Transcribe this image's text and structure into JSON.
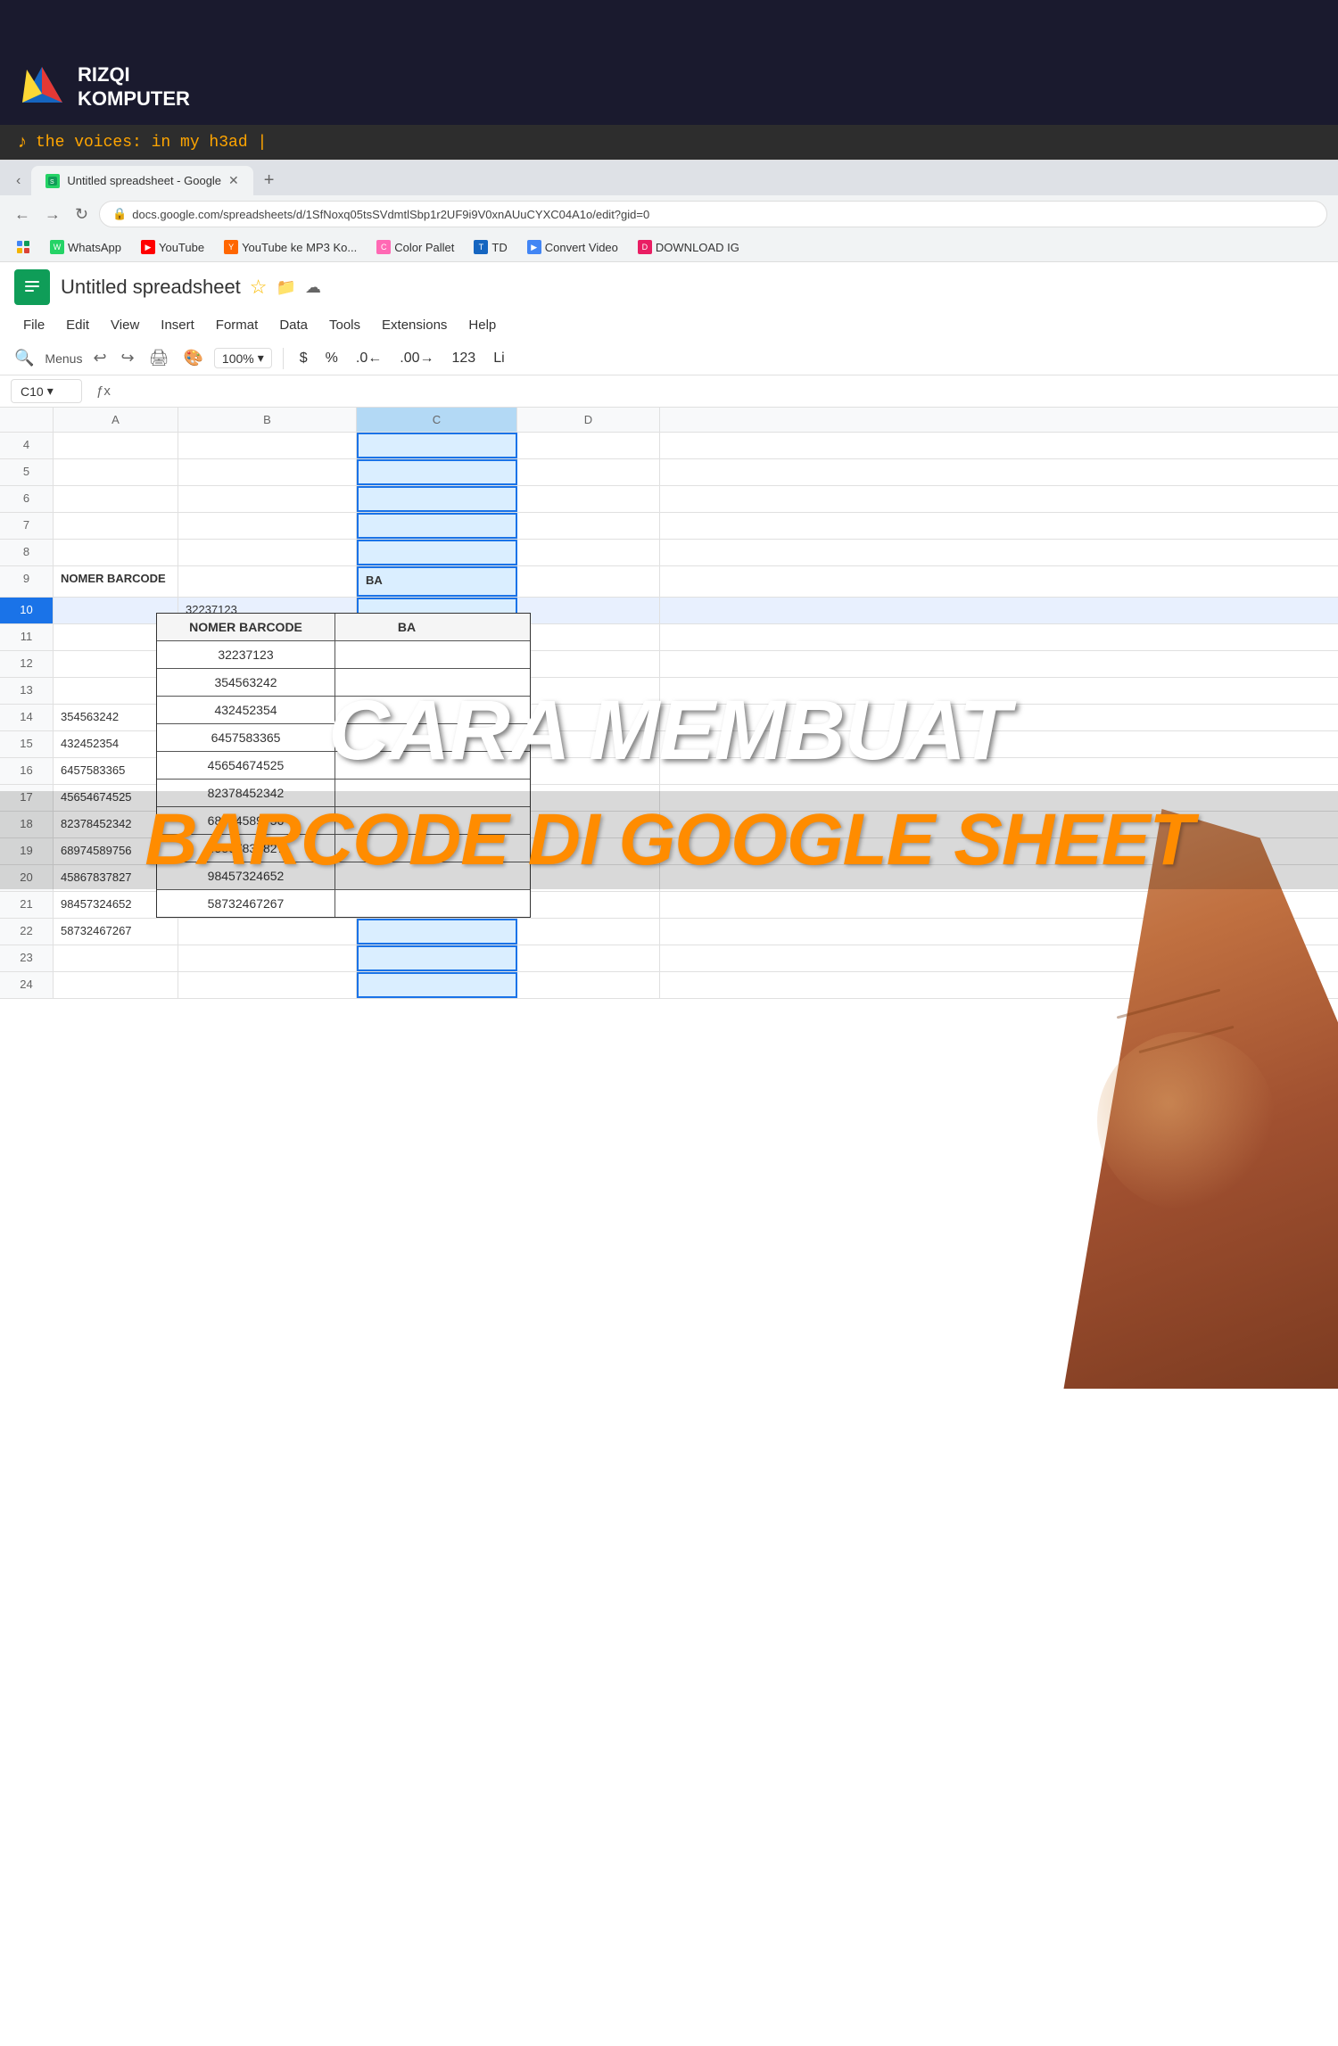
{
  "app": {
    "logo_name": "RIZQI",
    "logo_sub": "KOMPUTER"
  },
  "music_bar": {
    "text": "the voices: in my h3ad |"
  },
  "browser": {
    "tab_title": "Untitled spreadsheet - Google",
    "url": "docs.google.com/spreadsheets/d/1SfNoxq05tsSVdmtlSbp1r2UF9i9V0xnAUuCYXC04A1o/edit?gid=0",
    "bookmarks": [
      {
        "label": "WhatsApp",
        "color": "#25d366"
      },
      {
        "label": "YouTube",
        "color": "#ff0000"
      },
      {
        "label": "YouTube ke MP3 Ko...",
        "color": "#ff6600"
      },
      {
        "label": "Color Pallet",
        "color": "#ff69b4"
      },
      {
        "label": "TD",
        "color": "#1565c0"
      },
      {
        "label": "Convert Video",
        "color": "#4285f4"
      },
      {
        "label": "DOWNLOAD IG",
        "color": "#e91e63"
      }
    ]
  },
  "sheets": {
    "title": "Untitled spreadsheet",
    "cell_ref": "C10",
    "zoom": "100%",
    "menu_items": [
      "File",
      "Edit",
      "View",
      "Insert",
      "Format",
      "Data",
      "Tools",
      "Extensions",
      "Help"
    ],
    "columns": [
      "A",
      "B",
      "C",
      "D"
    ],
    "rows": [
      {
        "num": "4",
        "cells": [
          "",
          "",
          "",
          ""
        ]
      },
      {
        "num": "5",
        "cells": [
          "",
          "",
          "",
          ""
        ]
      },
      {
        "num": "6",
        "cells": [
          "",
          "",
          "",
          ""
        ]
      },
      {
        "num": "7",
        "cells": [
          "",
          "",
          "",
          ""
        ]
      },
      {
        "num": "8",
        "cells": [
          "",
          "",
          "",
          ""
        ]
      },
      {
        "num": "9",
        "cells": [
          "NOMER BARCODE",
          "",
          "BA",
          ""
        ],
        "is_header": true
      },
      {
        "num": "10",
        "cells": [
          "",
          "32237123",
          "",
          ""
        ],
        "is_selected": true
      },
      {
        "num": "11",
        "cells": [
          "",
          "",
          "",
          ""
        ]
      },
      {
        "num": "12",
        "cells": [
          "",
          "",
          "",
          ""
        ]
      },
      {
        "num": "13",
        "cells": [
          "",
          "",
          "",
          ""
        ]
      },
      {
        "num": "14",
        "cells": [
          "354563242",
          "",
          "",
          ""
        ]
      },
      {
        "num": "15",
        "cells": [
          "432452354",
          "",
          "",
          ""
        ]
      },
      {
        "num": "16",
        "cells": [
          "6457583365",
          "",
          "",
          ""
        ]
      },
      {
        "num": "17",
        "cells": [
          "45654674525",
          "",
          "",
          ""
        ]
      },
      {
        "num": "18",
        "cells": [
          "82378452342",
          "",
          "",
          ""
        ]
      },
      {
        "num": "19",
        "cells": [
          "68974589756",
          "",
          "",
          ""
        ]
      },
      {
        "num": "20",
        "cells": [
          "45867837827",
          "",
          "",
          ""
        ]
      },
      {
        "num": "21",
        "cells": [
          "98457324652",
          "",
          "",
          ""
        ]
      },
      {
        "num": "22",
        "cells": [
          "58732467267",
          "",
          "",
          ""
        ]
      },
      {
        "num": "23",
        "cells": [
          "",
          "",
          "",
          ""
        ]
      },
      {
        "num": "24",
        "cells": [
          "",
          "",
          "",
          ""
        ]
      }
    ]
  },
  "overlay": {
    "line1": "CARA MEMBUAT",
    "line2": "BARCODE DI GOOGLE SHEET"
  },
  "table": {
    "header": {
      "col1": "NOMER BARCODE",
      "col2": "BA"
    },
    "rows": [
      {
        "num": "32237123",
        "ba": ""
      },
      {
        "num": "354563242",
        "ba": ""
      },
      {
        "num": "432452354",
        "ba": ""
      },
      {
        "num": "6457583365",
        "ba": ""
      },
      {
        "num": "45654674525",
        "ba": ""
      },
      {
        "num": "82378452342",
        "ba": ""
      },
      {
        "num": "68974589756",
        "ba": ""
      },
      {
        "num": "45867837827",
        "ba": ""
      },
      {
        "num": "98457324652",
        "ba": ""
      },
      {
        "num": "58732467267",
        "ba": ""
      }
    ]
  }
}
